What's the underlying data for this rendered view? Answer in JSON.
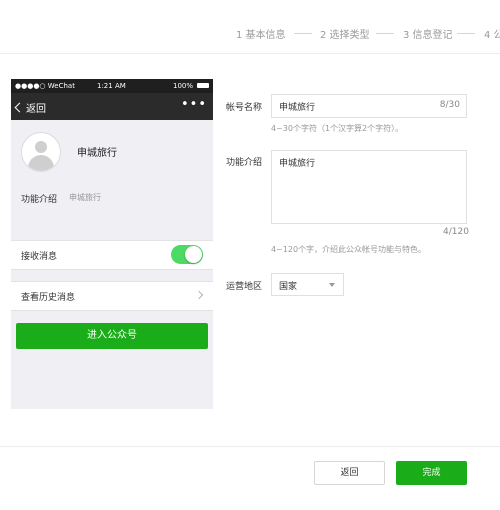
{
  "steps": [
    {
      "label": "1 基本信息"
    },
    {
      "label": "2 选择类型"
    },
    {
      "label": "3 信息登记"
    },
    {
      "label": "4 公"
    }
  ],
  "preview": {
    "status_carrier": "●●●●○ WeChat",
    "status_time": "1:21 AM",
    "status_battery": "100%",
    "back_label": "返回",
    "more_label": "•••",
    "account_name": "申城旅行",
    "intro_label": "功能介绍",
    "intro_value": "申城旅行",
    "receive_label": "接收消息",
    "receive_on": true,
    "history_label": "查看历史消息",
    "enter_label": "进入公众号"
  },
  "form": {
    "name_label": "帐号名称",
    "name_value": "申城旅行",
    "name_counter": "8/30",
    "name_hint": "4~30个字符（1个汉字算2个字符）。",
    "intro_label": "功能介绍",
    "intro_value": "申城旅行",
    "intro_counter": "4/120",
    "intro_hint": "4~120个字，介绍此公众帐号功能与特色。",
    "region_label": "运营地区",
    "region_value": "国家"
  },
  "footer": {
    "back_label": "返回",
    "finish_label": "完成"
  },
  "colors": {
    "accent_green": "#1aad19",
    "toggle_green": "#4cd964"
  }
}
